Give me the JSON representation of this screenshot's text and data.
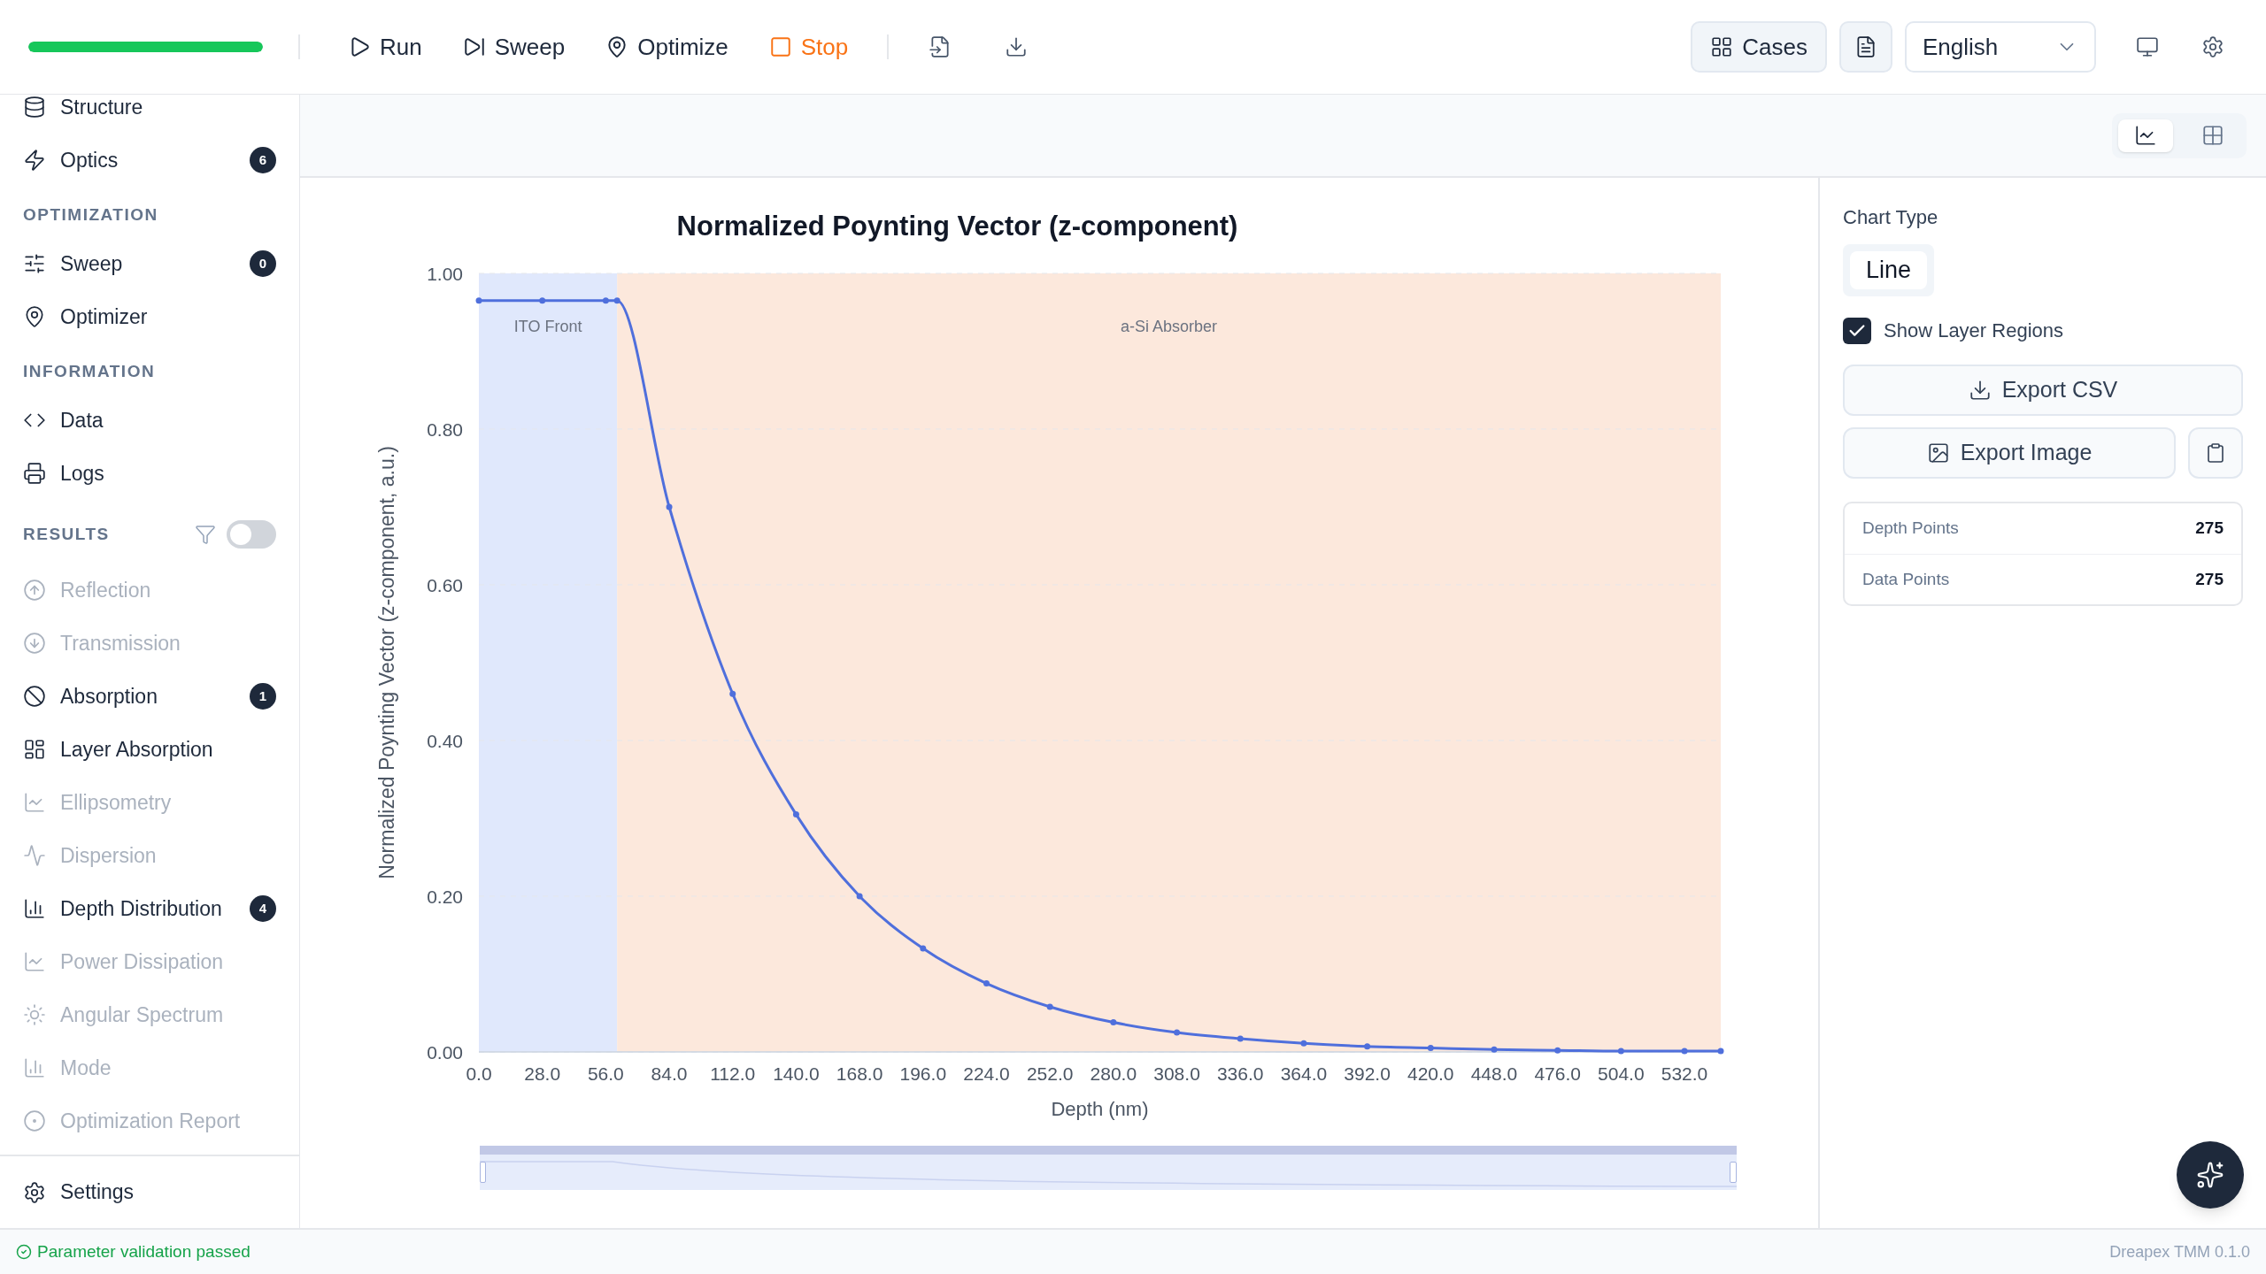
{
  "toolbar": {
    "progress": {
      "level": 1
    },
    "actions": [
      {
        "label": "Run",
        "kind": "action"
      },
      {
        "label": "Sweep",
        "kind": "action"
      },
      {
        "label": "Optimize",
        "kind": "action"
      },
      {
        "label": "Stop",
        "kind": "stop"
      }
    ],
    "cases_button": "Cases",
    "language": "English"
  },
  "sidebar": {
    "top_items": [
      {
        "label": "Structure",
        "disabled": false
      },
      {
        "label": "Optics",
        "disabled": false,
        "badge": "6"
      }
    ],
    "sections": [
      {
        "title": "OPTIMIZATION",
        "items": [
          {
            "label": "Sweep",
            "disabled": false,
            "badge": "0"
          },
          {
            "label": "Optimizer",
            "disabled": false
          }
        ]
      },
      {
        "title": "INFORMATION",
        "items": [
          {
            "label": "Data",
            "disabled": false
          },
          {
            "label": "Logs",
            "disabled": false
          }
        ]
      },
      {
        "title": "RESULTS",
        "filter_toggle": {
          "on": false
        },
        "items": [
          {
            "label": "Reflection",
            "disabled": true
          },
          {
            "label": "Transmission",
            "disabled": true
          },
          {
            "label": "Absorption",
            "disabled": false,
            "badge": "1"
          },
          {
            "label": "Layer Absorption",
            "disabled": false
          },
          {
            "label": "Ellipsometry",
            "disabled": true
          },
          {
            "label": "Dispersion",
            "disabled": true
          },
          {
            "label": "Depth Distribution",
            "disabled": false,
            "badge": "4"
          },
          {
            "label": "Power Dissipation",
            "disabled": true
          },
          {
            "label": "Angular Spectrum",
            "disabled": true
          },
          {
            "label": "Mode",
            "disabled": true
          },
          {
            "label": "Optimization Report",
            "disabled": true
          }
        ]
      }
    ],
    "settings": "Settings"
  },
  "zoom_range": {
    "level": 1
  },
  "view_toggle": [
    {
      "selected": true
    },
    {
      "selected": false
    }
  ],
  "chart": {
    "chart_data": {
      "type": "line",
      "title": "Normalized Poynting Vector (z-component)",
      "xlabel": "Depth (nm)",
      "ylabel": "Normalized Poynting Vector (z-component, a.u.)",
      "x": [
        0,
        28,
        56,
        61,
        84,
        112,
        140,
        168,
        196,
        224,
        252,
        280,
        308,
        336,
        364,
        392,
        420,
        448,
        476,
        504,
        532,
        548
      ],
      "grid": true,
      "series": [
        {
          "color": "#4f6fdc",
          "marker": "circle",
          "values": [
            0.965,
            0.965,
            0.965,
            0.965,
            0.7,
            0.46,
            0.305,
            0.2,
            0.133,
            0.088,
            0.058,
            0.038,
            0.025,
            0.017,
            0.011,
            0.007,
            0.005,
            0.003,
            0.002,
            0.001,
            0.001,
            0.001
          ]
        }
      ],
      "xlim": [
        0,
        548
      ],
      "ylim": [
        0,
        1
      ],
      "xticks": [
        {
          "value": 0,
          "label": "0.0"
        },
        {
          "value": 28,
          "label": "28.0"
        },
        {
          "value": 56,
          "label": "56.0"
        },
        {
          "value": 84,
          "label": "84.0"
        },
        {
          "value": 112,
          "label": "112.0"
        },
        {
          "value": 140,
          "label": "140.0"
        },
        {
          "value": 168,
          "label": "168.0"
        },
        {
          "value": 196,
          "label": "196.0"
        },
        {
          "value": 224,
          "label": "224.0"
        },
        {
          "value": 252,
          "label": "252.0"
        },
        {
          "value": 280,
          "label": "280.0"
        },
        {
          "value": 308,
          "label": "308.0"
        },
        {
          "value": 336,
          "label": "336.0"
        },
        {
          "value": 364,
          "label": "364.0"
        },
        {
          "value": 392,
          "label": "392.0"
        },
        {
          "value": 420,
          "label": "420.0"
        },
        {
          "value": 448,
          "label": "448.0"
        },
        {
          "value": 476,
          "label": "476.0"
        },
        {
          "value": 504,
          "label": "504.0"
        },
        {
          "value": 532,
          "label": "532.0"
        }
      ],
      "yticks": [
        {
          "value": 0,
          "label": "0.00"
        },
        {
          "value": 0.2,
          "label": "0.20"
        },
        {
          "value": 0.4,
          "label": "0.40"
        },
        {
          "value": 0.6,
          "label": "0.60"
        },
        {
          "value": 0.8,
          "label": "0.80"
        },
        {
          "value": 1,
          "label": "1.00"
        }
      ],
      "bands": [
        {
          "axis": "x",
          "label": "ITO Front",
          "from": 0,
          "to": 61,
          "color": "#e0e8fc"
        },
        {
          "axis": "x",
          "label": "a-Si Absorber",
          "from": 61,
          "to": 548,
          "color": "#fce8dc"
        }
      ]
    }
  },
  "panel": {
    "chart_type_label": "Chart Type",
    "chart_types": [
      {
        "label": "Line",
        "selected": true
      }
    ],
    "show_layer_regions": {
      "label": "Show Layer Regions",
      "checked": true
    },
    "export_csv": "Export CSV",
    "export_image": "Export Image",
    "stats": [
      {
        "label": "Depth Points",
        "value": "275"
      },
      {
        "label": "Data Points",
        "value": "275"
      }
    ]
  },
  "status_bar": {
    "message": "Parameter validation passed",
    "kind": "success",
    "version": "Dreapex TMM 0.1.0"
  }
}
